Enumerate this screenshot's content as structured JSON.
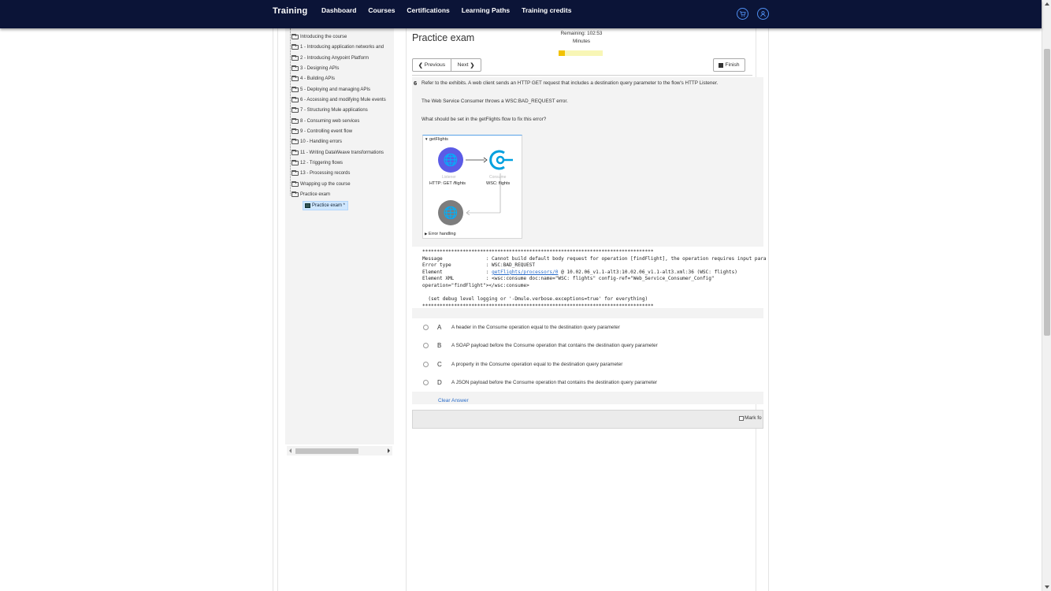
{
  "header": {
    "brand": "Training",
    "nav": [
      "Dashboard",
      "Courses",
      "Certifications",
      "Learning Paths",
      "Training credits"
    ],
    "icons": [
      "cart-icon",
      "user-icon"
    ],
    "accent": "#4f8ff2",
    "background": "#0b1437"
  },
  "outline": {
    "items": [
      "Introducing the course",
      "1 - Introducing application networks and",
      "2 - Introducing Anypoint Platform",
      "3 - Designing APIs",
      "4 - Building APIs",
      "5 - Deploying and managing APIs",
      "6 - Accessing and modifying Mule events",
      "7 - Structuring Mule applications",
      "8 - Consuming web services",
      "9 - Controlling event flow",
      "10 - Handling errors",
      "11 - Writing DataWeave transformations",
      "12 - Triggering flows",
      "13 - Processing records",
      "Wrapping up the course",
      "Practice exam"
    ],
    "selected": "Practice exam *"
  },
  "exam": {
    "title": "Practice exam",
    "remaining_label": "Remaining: 102:53",
    "remaining_unit": "Minutes",
    "progress_fraction": 0.05,
    "prev_label": "Previous",
    "next_label": "Next",
    "finish_label": "Finish"
  },
  "question": {
    "number": "6",
    "text1": "Refer to the exhibits. A web client sends an HTTP GET request that includes a destination query parameter to the flow's HTTP Listener.",
    "text2": "The Web Service Consumer throws a WSC:BAD_REQUEST error.",
    "text3": "What should be set in the getFlights flow to fix this error?",
    "flow": {
      "name": "getFlights",
      "listener_caption": "Listener",
      "listener_label": "HTTP: GET /flights",
      "consume_caption": "Consume",
      "consume_label": "WSC: flights",
      "error_handling": "Error handling"
    },
    "log": {
      "stars": "********************************************************************************",
      "message": "Message               : Cannot build default body request for operation [findFlight], the operation requires input para",
      "error_type": "Error type            : WSC:BAD_REQUEST",
      "element_prefix": "Element               : ",
      "element_link": "getFlights/processors/0",
      "element_suffix": " @ 10.02.06_v1.1-alt3:10.02.06_v1.1-alt3.xml:36 (WSC: flights)",
      "element_xml": "Element XML           : <wsc:consume doc:name=\"WSC: flights\" config-ref=\"Web_Service_Consumer_Config\"",
      "operation": "operation=\"findFlight\"></wsc:consume>",
      "debug": "  (set debug level logging or '-Dmule.verbose.exceptions=true' for everything)",
      "stars2": "********************************************************************************"
    },
    "answers": [
      {
        "letter": "A",
        "text": "A header in the Consume operation equal to the destination query parameter"
      },
      {
        "letter": "B",
        "text": "A SOAP payload before the Consume operation that contains the destination query parameter"
      },
      {
        "letter": "C",
        "text": "A property in the Consume operation equal to the destination query parameter"
      },
      {
        "letter": "D",
        "text": "A JSON payload before the Consume operation that contains the destination query parameter"
      }
    ],
    "clear_label": "Clear Answer",
    "mark_label": "Mark fo"
  }
}
